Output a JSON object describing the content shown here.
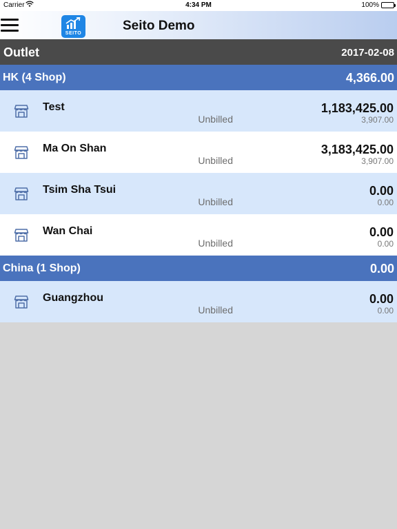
{
  "status_bar": {
    "carrier": "Carrier",
    "wifi_icon": "wifi-icon",
    "time": "4:34 PM",
    "battery": "100%"
  },
  "nav": {
    "menu_icon": "hamburger-menu-icon",
    "logo_text": "SEITO",
    "title": "Seito Demo"
  },
  "header": {
    "label": "Outlet",
    "date": "2017-02-08"
  },
  "groups": [
    {
      "name": "HK (4 Shop)",
      "total": "4,366.00",
      "shops": [
        {
          "name": "Test",
          "status": "Unbilled",
          "amount": "1,183,425.00",
          "sub_amount": "3,907.00"
        },
        {
          "name": "Ma On Shan",
          "status": "Unbilled",
          "amount": "3,183,425.00",
          "sub_amount": "3,907.00"
        },
        {
          "name": "Tsim Sha Tsui",
          "status": "Unbilled",
          "amount": "0.00",
          "sub_amount": "0.00"
        },
        {
          "name": "Wan Chai",
          "status": "Unbilled",
          "amount": "0.00",
          "sub_amount": "0.00"
        }
      ]
    },
    {
      "name": "China (1 Shop)",
      "total": "0.00",
      "shops": [
        {
          "name": "Guangzhou",
          "status": "Unbilled",
          "amount": "0.00",
          "sub_amount": "0.00"
        }
      ]
    }
  ],
  "colors": {
    "group_header": "#4a73bd",
    "header_bar": "#4a4a4a",
    "row_alt": "#d7e7fb",
    "row_plain": "#ffffff",
    "background": "#d6d6d6"
  }
}
